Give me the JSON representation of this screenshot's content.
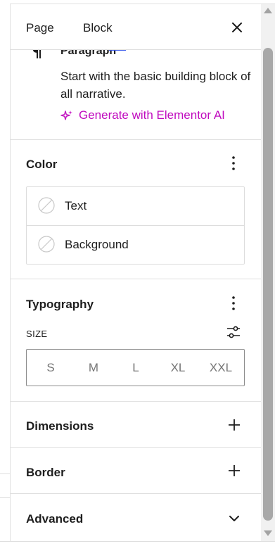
{
  "header": {
    "tabs": [
      {
        "label": "Page"
      },
      {
        "label": "Block"
      }
    ]
  },
  "block": {
    "title": "Paragraph",
    "description": "Start with the basic building block of all narrative.",
    "ai_link": "Generate with Elementor AI",
    "ai_color": "#c00bbf"
  },
  "color": {
    "title": "Color",
    "items": [
      {
        "label": "Text"
      },
      {
        "label": "Background"
      }
    ]
  },
  "typography": {
    "title": "Typography",
    "size_label": "SIZE",
    "size_options": [
      "S",
      "M",
      "L",
      "XL",
      "XXL"
    ]
  },
  "sections": [
    {
      "title": "Dimensions",
      "icon": "plus-icon"
    },
    {
      "title": "Border",
      "icon": "plus-icon"
    },
    {
      "title": "Advanced",
      "icon": "chevron-down-icon"
    }
  ]
}
